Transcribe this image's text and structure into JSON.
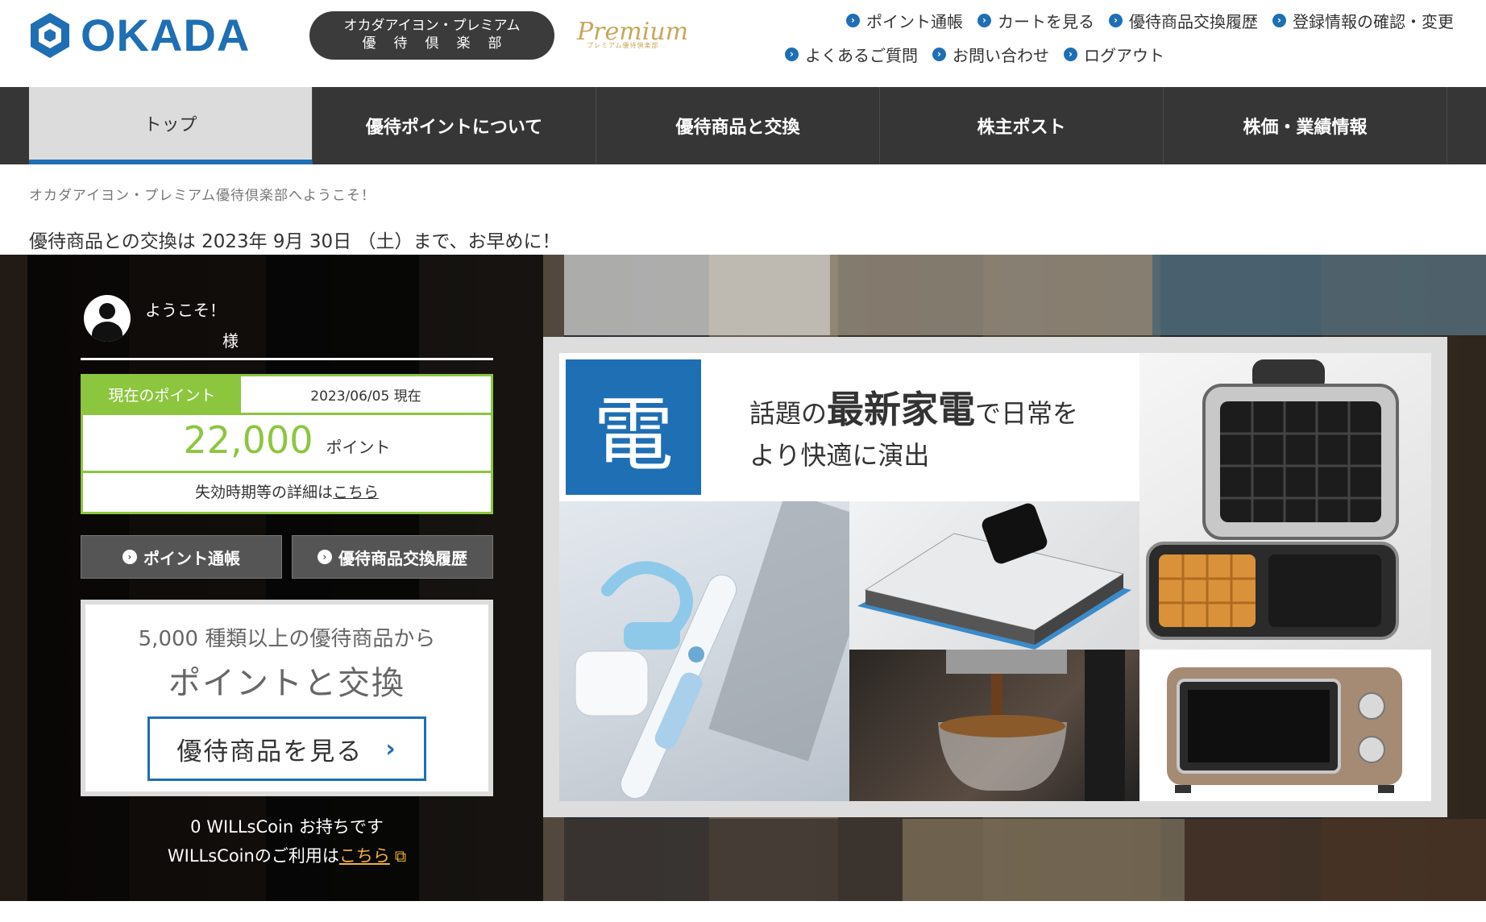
{
  "header": {
    "logo_text": "OKADA",
    "club_line1": "オカダアイヨン・プレミアム",
    "club_line2": "優待倶楽部",
    "premium_script": "Premium",
    "premium_sub": "プレミアム優待倶楽部",
    "brand_color": "#1e6fb4"
  },
  "util_nav": {
    "row1": [
      "ポイント通帳",
      "カートを見る",
      "優待商品交換履歴",
      "登録情報の確認・変更"
    ],
    "row2": [
      "よくあるご質問",
      "お問い合わせ",
      "ログアウト"
    ]
  },
  "main_nav": {
    "items": [
      "トップ",
      "優待ポイントについて",
      "優待商品と交換",
      "株主ポスト",
      "株価・業績情報"
    ],
    "active": "トップ"
  },
  "welcome_text": "オカダアイヨン・プレミアム優待倶楽部へようこそ！",
  "deadline_text": "優待商品との交換は 2023年 9月 30日 （土）まで、お早めに！",
  "user": {
    "greeting": "ようこそ！",
    "honorific": "様"
  },
  "points": {
    "label": "現在のポイント",
    "as_of": "2023/06/05 現在",
    "value": "22,000",
    "unit": "ポイント",
    "expiry_prefix": "失効時期等の詳細は",
    "expiry_link": "こちら",
    "accent_color": "#8cc63f"
  },
  "buttons": {
    "passbook": "ポイント通帳",
    "history": "優待商品交換履歴"
  },
  "exchange_card": {
    "line1": "5,000 種類以上の優待商品から",
    "line2": "ポイントと交換",
    "cta": "優待商品を見る"
  },
  "coin": {
    "balance_text": "0 WILLsCoin お持ちです",
    "usage_prefix": "WILLsCoinのご利用は",
    "usage_link": "こちら"
  },
  "promo": {
    "badge": "電",
    "copy_pre": "話題の",
    "copy_big": "最新家電",
    "copy_post": "で日常を",
    "copy_line2": "より快適に演出"
  }
}
